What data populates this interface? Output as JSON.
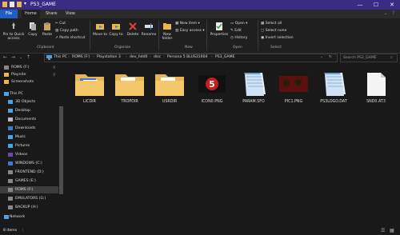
{
  "window": {
    "title": "PS3_GAME",
    "min": "—",
    "max": "☐",
    "close": "✕"
  },
  "tabs": {
    "file": "File",
    "home": "Home",
    "share": "Share",
    "view": "View"
  },
  "ribbon": {
    "pin": "Pin to Quick access",
    "copy": "Copy",
    "paste": "Paste",
    "cut": "Cut",
    "copy_path": "Copy path",
    "paste_shortcut": "Paste shortcut",
    "clipboard": "Clipboard",
    "move_to": "Move to",
    "copy_to": "Copy to",
    "delete": "Delete",
    "rename": "Rename",
    "organize": "Organize",
    "new_folder": "New folder",
    "new_item": "New item ▾",
    "easy_access": "Easy access ▾",
    "new_group": "New",
    "properties": "Properties",
    "open": "Open ▾",
    "edit": "Edit",
    "history": "History",
    "open_group": "Open",
    "select_all": "Select all",
    "select_none": "Select none",
    "invert": "Invert selection",
    "select_group": "Select"
  },
  "address": {
    "crumbs": [
      "This PC",
      "ROMS (F:)",
      "Playstation 3",
      "dev_hdd0",
      "disc",
      "Persona 5 BLUS31604",
      "PS3_GAME"
    ],
    "search_placeholder": "Search PS3_GAME"
  },
  "sidebar": {
    "items": [
      {
        "label": "ROMS (F:)"
      },
      {
        "label": "Playnite"
      },
      {
        "label": "Screenshots"
      },
      {
        "label": "This PC"
      },
      {
        "label": "3D Objects"
      },
      {
        "label": "Desktop"
      },
      {
        "label": "Documents"
      },
      {
        "label": "Downloads"
      },
      {
        "label": "Music"
      },
      {
        "label": "Pictures"
      },
      {
        "label": "Videos"
      },
      {
        "label": "WINDOWS (C:)"
      },
      {
        "label": "FRONTEND (D:)"
      },
      {
        "label": "GAMES (E:)"
      },
      {
        "label": "ROMS (F:)"
      },
      {
        "label": "EMULATORS (G:)"
      },
      {
        "label": "BACKUP (H:)"
      },
      {
        "label": "Network"
      }
    ]
  },
  "files": [
    {
      "name": "LICDIR"
    },
    {
      "name": "TROPDIR"
    },
    {
      "name": "USRDIR"
    },
    {
      "name": "ICON0.PNG"
    },
    {
      "name": "PARAM.SFO"
    },
    {
      "name": "PIC1.PNG"
    },
    {
      "name": "PS3LOGO.DAT"
    },
    {
      "name": "SND0.AT3"
    }
  ],
  "status": {
    "count": "8 items",
    "sep": "|"
  },
  "colors": {
    "titlebar": "#3a2b84",
    "accent": "#1f5fbf",
    "folder": "#f4c86a"
  }
}
